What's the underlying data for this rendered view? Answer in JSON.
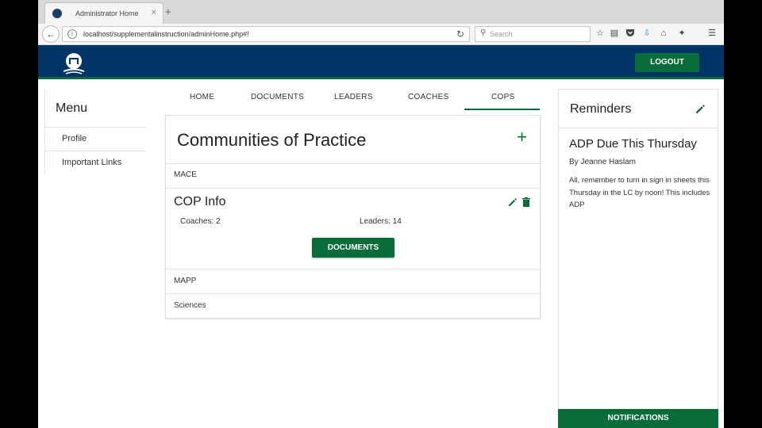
{
  "browser": {
    "tab_title": "Administrator Home",
    "tab_close": "×",
    "new_tab": "+",
    "url": "localhost/supplementalinstruction/adminHome.php#!",
    "search_placeholder": "Search"
  },
  "header": {
    "logout_label": "LOGOUT",
    "brand_color": "#003466",
    "accent_color": "#0a6b3b"
  },
  "menu": {
    "title": "Menu",
    "items": [
      {
        "label": "Profile"
      },
      {
        "label": "Important Links"
      }
    ]
  },
  "tabs": [
    {
      "label": "HOME"
    },
    {
      "label": "DOCUMENTS"
    },
    {
      "label": "LEADERS"
    },
    {
      "label": "COACHES"
    },
    {
      "label": "COPS",
      "active": true
    }
  ],
  "cops": {
    "title": "Communities of Practice",
    "add_icon": "+",
    "rows": [
      "MACE",
      "MAPP",
      "Sciences"
    ],
    "expanded": {
      "title": "COP Info",
      "coaches_text": "Coaches: 2",
      "leaders_text": "Leaders: 14",
      "documents_label": "DOCUMENTS"
    }
  },
  "reminders": {
    "title": "Reminders",
    "item": {
      "heading": "ADP Due This Thursday",
      "author": "By Jeanne Haslam",
      "body": "All, remember to turn in sign in sheets this Thursday in the LC by noon! This includes ADP"
    },
    "notifications_label": "NOTIFICATIONS"
  }
}
